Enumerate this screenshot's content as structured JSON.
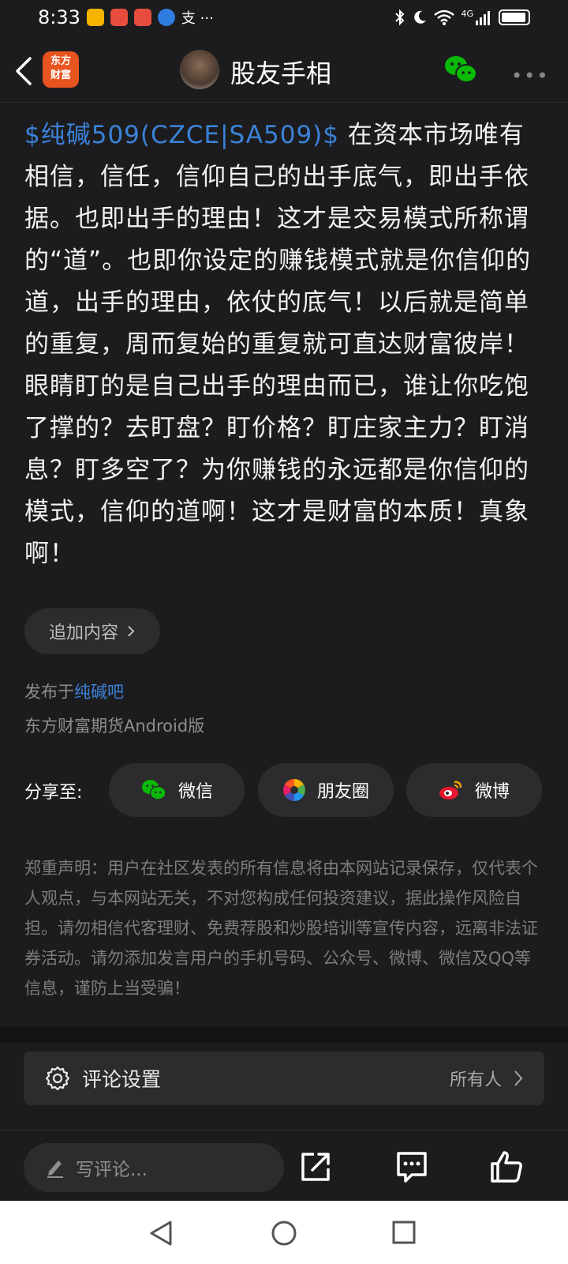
{
  "status_bar": {
    "time": "8:33",
    "notif_text": "支 ···",
    "network": "4G"
  },
  "header": {
    "logo_line1": "东方",
    "logo_line2": "财富",
    "title": "股友手相"
  },
  "post": {
    "stock_tag": "$纯碱509(CZCE|SA509)$",
    "content": " 在资本市场唯有相信，信任，信仰自己的出手底气，即出手依据。也即出手的理由！这才是交易模式所称谓的“道”。也即你设定的赚钱模式就是你信仰的道，出手的理由，依仗的底气！以后就是简单的重复，周而复始的重复就可直达财富彼岸！眼睛盯的是自己出手的理由而已，谁让你吃饱了撑的？去盯盘？盯价格？盯庄家主力？盯消息？盯多空了？为你赚钱的永远都是你信仰的模式，信仰的道啊！这才是财富的本质！真象啊！",
    "add_content_label": "追加内容",
    "published_prefix": "发布于",
    "published_bar": "纯碱吧",
    "source": "东方财富期货Android版"
  },
  "share": {
    "label": "分享至:",
    "wechat": "微信",
    "moments": "朋友圈",
    "weibo": "微博"
  },
  "disclaimer": "郑重声明：用户在社区发表的所有信息将由本网站记录保存，仅代表个人观点，与本网站无关，不对您构成任何投资建议，据此操作风险自担。请勿相信代客理财、免费荐股和炒股培训等宣传内容，远离非法证券活动。请勿添加发言用户的手机号码、公众号、微博、微信及QQ等信息，谨防上当受骗！",
  "comment_settings": {
    "label": "评论设置",
    "value": "所有人"
  },
  "bottom_bar": {
    "comment_placeholder": "写评论..."
  },
  "colors": {
    "background": "#1c1c1e",
    "link_blue": "#3b82d8",
    "brand_orange": "#e8541f",
    "wechat_green": "#09bb07"
  }
}
